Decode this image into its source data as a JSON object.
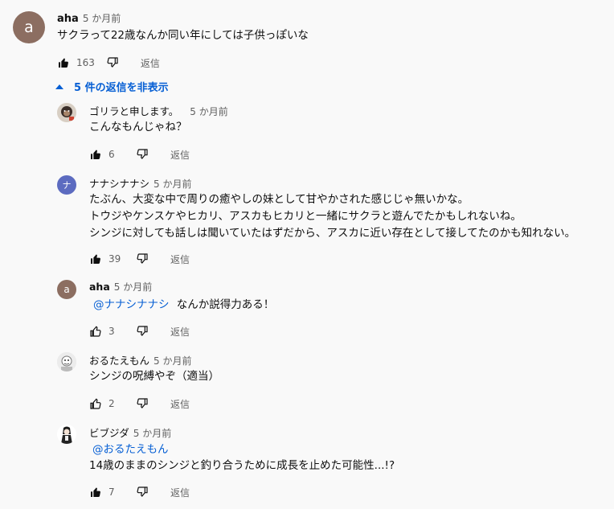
{
  "main_comment": {
    "avatar_letter": "a",
    "avatar_color": "#8c6e61",
    "author": "aha",
    "time": "5 か月前",
    "text": "サクラって22歳なんか同い年にしては子供っぽいな",
    "likes": "163",
    "reply_label": "返信"
  },
  "hide_replies_label": "5 件の返信を非表示",
  "replies": [
    {
      "avatar_type": "image",
      "author": "ゴリラと申します。",
      "time": "5 か月前",
      "mention": "",
      "lines": [
        "こんなもんじゃね？"
      ],
      "likes": "6",
      "liked": true,
      "reply_label": "返信"
    },
    {
      "avatar_type": "letter",
      "avatar_letter": "ナ",
      "avatar_color": "#5c6bc0",
      "author": "ナナシナナシ",
      "time": "5 か月前",
      "mention": "",
      "lines": [
        "たぶん、大変な中で周りの癒やしの妹として甘やかされた感じじゃ無いかな。",
        "トウジやケンスケやヒカリ、アスカもヒカリと一緒にサクラと遊んでたかもしれないね。",
        "シンジに対しても話しは聞いていたはずだから、アスカに近い存在として接してたのかも知れない。"
      ],
      "likes": "39",
      "liked": true,
      "reply_label": "返信"
    },
    {
      "avatar_type": "letter",
      "avatar_letter": "a",
      "avatar_color": "#8c6e61",
      "author": "aha",
      "time": "5 か月前",
      "mention": "@ナナシナナシ",
      "lines": [
        "なんか説得力ある！"
      ],
      "likes": "3",
      "liked": false,
      "reply_label": "返信"
    },
    {
      "avatar_type": "image",
      "author": "おるたえもん",
      "time": "5 か月前",
      "mention": "",
      "lines": [
        "シンジの呪縛やぞ（適当）"
      ],
      "likes": "2",
      "liked": false,
      "reply_label": "返信"
    },
    {
      "avatar_type": "image",
      "author": "ビブジダ",
      "time": "5 か月前",
      "mention": "@おるたえもん",
      "lines": [
        "14歳のままのシンジと釣り合うために成長を止めた可能性...!?"
      ],
      "likes": "7",
      "liked": true,
      "reply_label": "返信"
    }
  ]
}
